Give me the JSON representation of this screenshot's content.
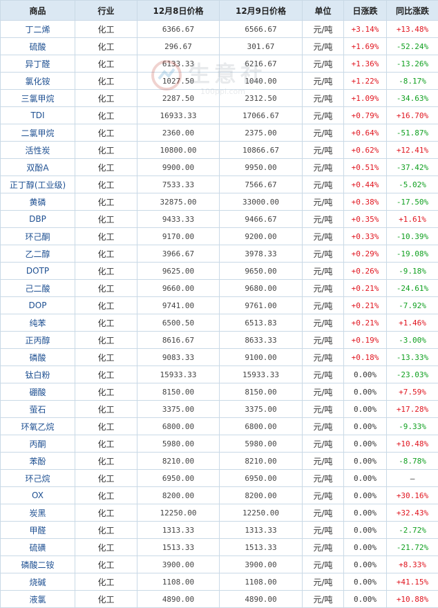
{
  "headers": {
    "product": "商品",
    "industry": "行业",
    "price_dec8": "12月8日价格",
    "price_dec9": "12月9日价格",
    "unit": "单位",
    "daily_change": "日涨跌",
    "yoy_change": "同比涨跌"
  },
  "watermark": {
    "text": "生意社",
    "url": "100ppi.com"
  },
  "colors": {
    "up": "#e0141e",
    "down": "#10a020",
    "header_bg": "#dbe8f3",
    "link": "#1d4f91"
  },
  "rows": [
    {
      "name": "丁二烯",
      "industry": "化工",
      "p8": "6366.67",
      "p9": "6566.67",
      "unit": "元/吨",
      "daily": "+3.14%",
      "yoy": "+13.48%"
    },
    {
      "name": "硫酸",
      "industry": "化工",
      "p8": "296.67",
      "p9": "301.67",
      "unit": "元/吨",
      "daily": "+1.69%",
      "yoy": "-52.24%"
    },
    {
      "name": "异丁醛",
      "industry": "化工",
      "p8": "6133.33",
      "p9": "6216.67",
      "unit": "元/吨",
      "daily": "+1.36%",
      "yoy": "-13.26%"
    },
    {
      "name": "氯化铵",
      "industry": "化工",
      "p8": "1027.50",
      "p9": "1040.00",
      "unit": "元/吨",
      "daily": "+1.22%",
      "yoy": "-8.17%"
    },
    {
      "name": "三氯甲烷",
      "industry": "化工",
      "p8": "2287.50",
      "p9": "2312.50",
      "unit": "元/吨",
      "daily": "+1.09%",
      "yoy": "-34.63%"
    },
    {
      "name": "TDI",
      "industry": "化工",
      "p8": "16933.33",
      "p9": "17066.67",
      "unit": "元/吨",
      "daily": "+0.79%",
      "yoy": "+16.70%"
    },
    {
      "name": "二氯甲烷",
      "industry": "化工",
      "p8": "2360.00",
      "p9": "2375.00",
      "unit": "元/吨",
      "daily": "+0.64%",
      "yoy": "-51.87%"
    },
    {
      "name": "活性炭",
      "industry": "化工",
      "p8": "10800.00",
      "p9": "10866.67",
      "unit": "元/吨",
      "daily": "+0.62%",
      "yoy": "+12.41%"
    },
    {
      "name": "双酚A",
      "industry": "化工",
      "p8": "9900.00",
      "p9": "9950.00",
      "unit": "元/吨",
      "daily": "+0.51%",
      "yoy": "-37.42%"
    },
    {
      "name": "正丁醇(工业级)",
      "industry": "化工",
      "p8": "7533.33",
      "p9": "7566.67",
      "unit": "元/吨",
      "daily": "+0.44%",
      "yoy": "-5.02%"
    },
    {
      "name": "黄磷",
      "industry": "化工",
      "p8": "32875.00",
      "p9": "33000.00",
      "unit": "元/吨",
      "daily": "+0.38%",
      "yoy": "-17.50%"
    },
    {
      "name": "DBP",
      "industry": "化工",
      "p8": "9433.33",
      "p9": "9466.67",
      "unit": "元/吨",
      "daily": "+0.35%",
      "yoy": "+1.61%"
    },
    {
      "name": "环己酮",
      "industry": "化工",
      "p8": "9170.00",
      "p9": "9200.00",
      "unit": "元/吨",
      "daily": "+0.33%",
      "yoy": "-10.39%"
    },
    {
      "name": "乙二醇",
      "industry": "化工",
      "p8": "3966.67",
      "p9": "3978.33",
      "unit": "元/吨",
      "daily": "+0.29%",
      "yoy": "-19.08%"
    },
    {
      "name": "DOTP",
      "industry": "化工",
      "p8": "9625.00",
      "p9": "9650.00",
      "unit": "元/吨",
      "daily": "+0.26%",
      "yoy": "-9.18%"
    },
    {
      "name": "己二酸",
      "industry": "化工",
      "p8": "9660.00",
      "p9": "9680.00",
      "unit": "元/吨",
      "daily": "+0.21%",
      "yoy": "-24.61%"
    },
    {
      "name": "DOP",
      "industry": "化工",
      "p8": "9741.00",
      "p9": "9761.00",
      "unit": "元/吨",
      "daily": "+0.21%",
      "yoy": "-7.92%"
    },
    {
      "name": "纯苯",
      "industry": "化工",
      "p8": "6500.50",
      "p9": "6513.83",
      "unit": "元/吨",
      "daily": "+0.21%",
      "yoy": "+1.46%"
    },
    {
      "name": "正丙醇",
      "industry": "化工",
      "p8": "8616.67",
      "p9": "8633.33",
      "unit": "元/吨",
      "daily": "+0.19%",
      "yoy": "-3.00%"
    },
    {
      "name": "磷酸",
      "industry": "化工",
      "p8": "9083.33",
      "p9": "9100.00",
      "unit": "元/吨",
      "daily": "+0.18%",
      "yoy": "-13.33%"
    },
    {
      "name": "钛白粉",
      "industry": "化工",
      "p8": "15933.33",
      "p9": "15933.33",
      "unit": "元/吨",
      "daily": "0.00%",
      "yoy": "-23.03%"
    },
    {
      "name": "硼酸",
      "industry": "化工",
      "p8": "8150.00",
      "p9": "8150.00",
      "unit": "元/吨",
      "daily": "0.00%",
      "yoy": "+7.59%"
    },
    {
      "name": "萤石",
      "industry": "化工",
      "p8": "3375.00",
      "p9": "3375.00",
      "unit": "元/吨",
      "daily": "0.00%",
      "yoy": "+17.28%"
    },
    {
      "name": "环氧乙烷",
      "industry": "化工",
      "p8": "6800.00",
      "p9": "6800.00",
      "unit": "元/吨",
      "daily": "0.00%",
      "yoy": "-9.33%"
    },
    {
      "name": "丙酮",
      "industry": "化工",
      "p8": "5980.00",
      "p9": "5980.00",
      "unit": "元/吨",
      "daily": "0.00%",
      "yoy": "+10.48%"
    },
    {
      "name": "苯酚",
      "industry": "化工",
      "p8": "8210.00",
      "p9": "8210.00",
      "unit": "元/吨",
      "daily": "0.00%",
      "yoy": "-8.78%"
    },
    {
      "name": "环己烷",
      "industry": "化工",
      "p8": "6950.00",
      "p9": "6950.00",
      "unit": "元/吨",
      "daily": "0.00%",
      "yoy": "—"
    },
    {
      "name": "OX",
      "industry": "化工",
      "p8": "8200.00",
      "p9": "8200.00",
      "unit": "元/吨",
      "daily": "0.00%",
      "yoy": "+30.16%"
    },
    {
      "name": "炭黑",
      "industry": "化工",
      "p8": "12250.00",
      "p9": "12250.00",
      "unit": "元/吨",
      "daily": "0.00%",
      "yoy": "+32.43%"
    },
    {
      "name": "甲醛",
      "industry": "化工",
      "p8": "1313.33",
      "p9": "1313.33",
      "unit": "元/吨",
      "daily": "0.00%",
      "yoy": "-2.72%"
    },
    {
      "name": "硫磺",
      "industry": "化工",
      "p8": "1513.33",
      "p9": "1513.33",
      "unit": "元/吨",
      "daily": "0.00%",
      "yoy": "-21.72%"
    },
    {
      "name": "磷酸二铵",
      "industry": "化工",
      "p8": "3900.00",
      "p9": "3900.00",
      "unit": "元/吨",
      "daily": "0.00%",
      "yoy": "+8.33%"
    },
    {
      "name": "烧碱",
      "industry": "化工",
      "p8": "1108.00",
      "p9": "1108.00",
      "unit": "元/吨",
      "daily": "0.00%",
      "yoy": "+41.15%"
    },
    {
      "name": "液氯",
      "industry": "化工",
      "p8": "4890.00",
      "p9": "4890.00",
      "unit": "元/吨",
      "daily": "0.00%",
      "yoy": "+10.88%"
    }
  ]
}
